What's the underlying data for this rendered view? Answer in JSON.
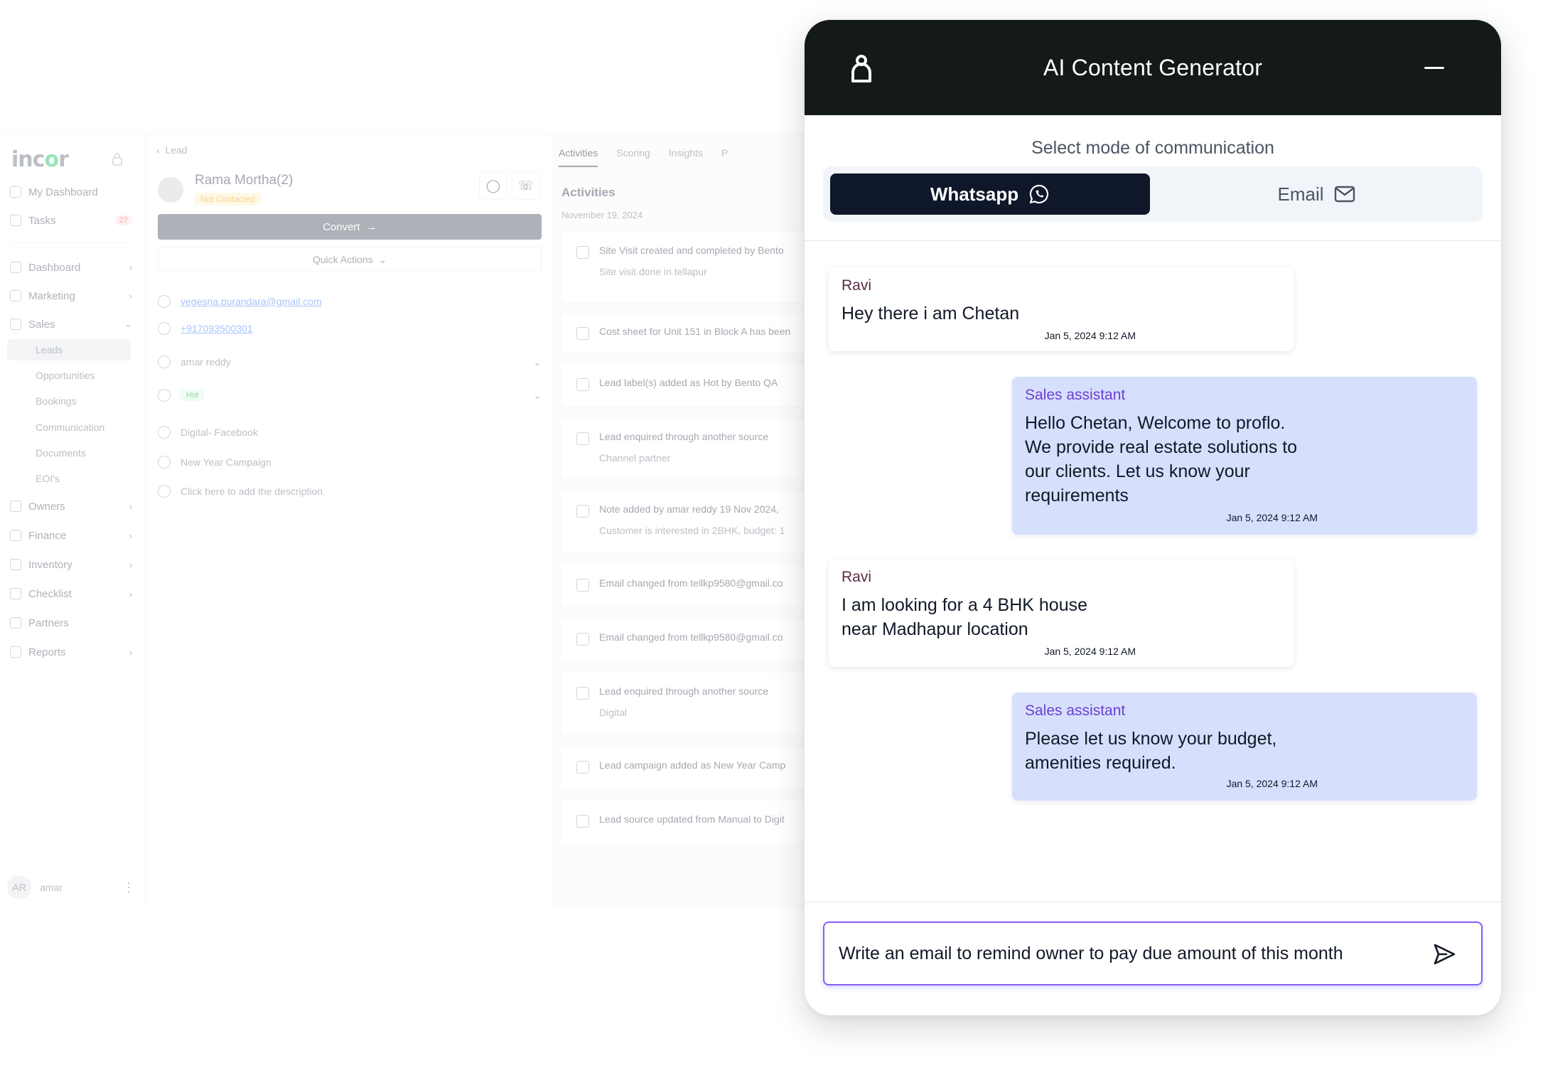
{
  "app": {
    "logo": "incor",
    "nav": [
      {
        "label": "My Dashboard",
        "icon": "user-icon"
      },
      {
        "label": "Tasks",
        "icon": "calendar-icon",
        "badge": "27"
      },
      {
        "label": "Dashboard",
        "icon": "chart-icon"
      },
      {
        "label": "Marketing",
        "icon": "megaphone-icon"
      },
      {
        "label": "Sales",
        "icon": "dollar-icon"
      },
      {
        "label": "Leads"
      },
      {
        "label": "Opportunities"
      },
      {
        "label": "Bookings"
      },
      {
        "label": "Communication"
      },
      {
        "label": "Documents"
      },
      {
        "label": "EOI's"
      },
      {
        "label": "Owners",
        "icon": "users-icon"
      },
      {
        "label": "Finance",
        "icon": "rupee-icon"
      },
      {
        "label": "Inventory",
        "icon": "building-icon"
      },
      {
        "label": "Checklist",
        "icon": "clipboard-icon"
      },
      {
        "label": "Partners",
        "icon": "partners-icon"
      },
      {
        "label": "Reports",
        "icon": "report-icon"
      }
    ],
    "user": {
      "initials": "AR",
      "name": "amar"
    }
  },
  "lead": {
    "breadcrumb": "Lead",
    "name": "Rama Mortha(2)",
    "status": "Not Contacted",
    "convert_label": "Convert",
    "quick_actions_label": "Quick Actions",
    "email": "vegesna.purandara@gmail.com",
    "phone": "+917093500301",
    "owner": "amar reddy",
    "tag": "Hot",
    "source": "Digital- Facebook",
    "campaign": "New Year Campaign",
    "description_placeholder": "Click here to add the description"
  },
  "activities": {
    "tabs": [
      "Activities",
      "Scoring",
      "Insights",
      "P"
    ],
    "title": "Activities",
    "date": "November 19, 2024",
    "items": [
      {
        "line1": "Site Visit created and completed by Bento",
        "line2": "Site visit done in tellapur"
      },
      {
        "line1": "Cost sheet for Unit 151 in Block A has been",
        "line2": ""
      },
      {
        "line1": "Lead label(s) added as Hot by Bento QA",
        "line2": ""
      },
      {
        "line1": "Lead enquired through another source",
        "line2": "Channel partner"
      },
      {
        "line1": "Note added by amar reddy   19 Nov 2024,",
        "line2": "Customer is interested in 2BHK, budget: 1"
      },
      {
        "line1": "Email changed from tellkp9580@gmail.co",
        "line2": ""
      },
      {
        "line1": "Email changed from tellkp9580@gmail.co",
        "line2": ""
      },
      {
        "line1": "Lead enquired through another source",
        "line2": "Digital"
      },
      {
        "line1": "Lead campaign added as New Year Camp",
        "line2": ""
      },
      {
        "line1": "Lead source updated from Manual to Digit",
        "line2": ""
      }
    ]
  },
  "ai": {
    "title": "AI Content Generator",
    "subtitle": "Select mode of communication",
    "modes": {
      "whatsapp": "Whatsapp",
      "email": "Email",
      "selected": "whatsapp"
    },
    "messages": [
      {
        "sender": "Ravi",
        "text": "Hey there i am Chetan",
        "time": "Jan 5, 2024  9:12 AM",
        "direction": "in"
      },
      {
        "sender": "Sales assistant",
        "text": "Hello Chetan, Welcome to proflo.\nWe provide real estate solutions to\nour clients. Let us know your\nrequirements",
        "time": "Jan 5, 2024  9:12 AM",
        "direction": "out"
      },
      {
        "sender": "Ravi",
        "text": "I am looking for a 4 BHK house\nnear Madhapur location",
        "time": "Jan 5, 2024  9:12 AM",
        "direction": "in"
      },
      {
        "sender": "Sales assistant",
        "text": "Please let us know your budget,\namenities required.",
        "time": "Jan 5, 2024  9:12 AM",
        "direction": "out"
      }
    ],
    "input_value": "Write an email to remind owner to pay due amount of this month"
  },
  "colors": {
    "header_bg": "#141a15",
    "selected_mode_bg": "#0f172a",
    "outgoing_bubble": "#d6e0fd",
    "input_border": "#8b5cf6"
  }
}
